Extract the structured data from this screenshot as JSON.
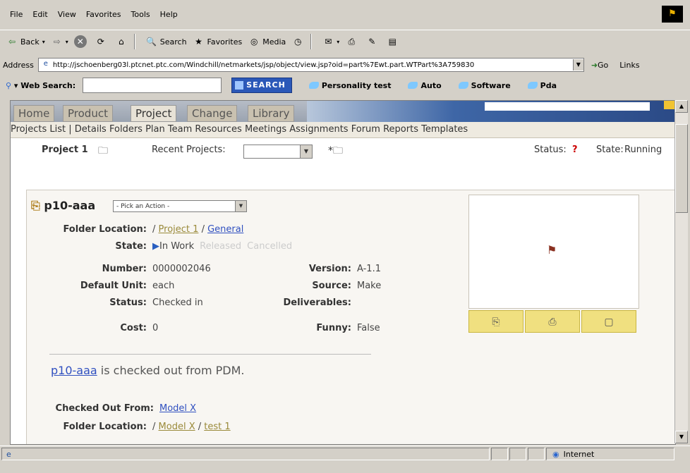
{
  "menu": [
    "File",
    "Edit",
    "View",
    "Favorites",
    "Tools",
    "Help"
  ],
  "toolbar": {
    "back": "Back",
    "search": "Search",
    "favorites": "Favorites",
    "media": "Media"
  },
  "address": {
    "label": "Address",
    "url": "http://jschoenberg03l.ptcnet.ptc.com/Windchill/netmarkets/jsp/object/view.jsp?oid=part%7Ewt.part.WTPart%3A759830",
    "go": "Go",
    "links": "Links"
  },
  "websearch": {
    "label": "Web Search:",
    "button": "SEARCH",
    "links": [
      "Personality test",
      "Auto",
      "Software",
      "Pda"
    ]
  },
  "tabs": [
    {
      "label": "Home"
    },
    {
      "label": "Product"
    },
    {
      "label": "Project",
      "active": true
    },
    {
      "label": "Change"
    },
    {
      "label": "Library"
    }
  ],
  "subnav": [
    "Projects List",
    "Details",
    "Folders",
    "Plan",
    "Team",
    "Resources",
    "Meetings",
    "Assignments",
    "Forum",
    "Reports",
    "Templates"
  ],
  "project": {
    "name": "Project 1",
    "recent_label": "Recent Projects:",
    "status_label": "Status:",
    "status_value": "?",
    "state_label": "State:",
    "state_value": "Running"
  },
  "part": {
    "title": "p10-aaa",
    "action_placeholder": "- Pick an Action -",
    "folder_label": "Folder Location:",
    "folder_root": "/",
    "folder_proj": "Project 1",
    "folder_sep": "/",
    "folder_sub": "General",
    "state_label": "State:",
    "state_current": "In Work",
    "state_next1": "Released",
    "state_next2": "Cancelled",
    "number_label": "Number:",
    "number_value": "0000002046",
    "version_label": "Version:",
    "version_value": "A-1.1",
    "unit_label": "Default Unit:",
    "unit_value": "each",
    "source_label": "Source:",
    "source_value": "Make",
    "status_label": "Status:",
    "status_value": "Checked in",
    "deliverables_label": "Deliverables:",
    "cost_label": "Cost:",
    "cost_value": "0",
    "funny_label": "Funny:",
    "funny_value": "False"
  },
  "checkout": {
    "msg_link": "p10-aaa",
    "msg_text": "is checked out from PDM.",
    "from_label": "Checked Out From:",
    "from_value": "Model X",
    "folder_label": "Folder Location:",
    "folder_root": "/",
    "folder_a": "Model X",
    "folder_sep": "/",
    "folder_b": "test 1"
  },
  "statusbar": {
    "zone": "Internet"
  }
}
